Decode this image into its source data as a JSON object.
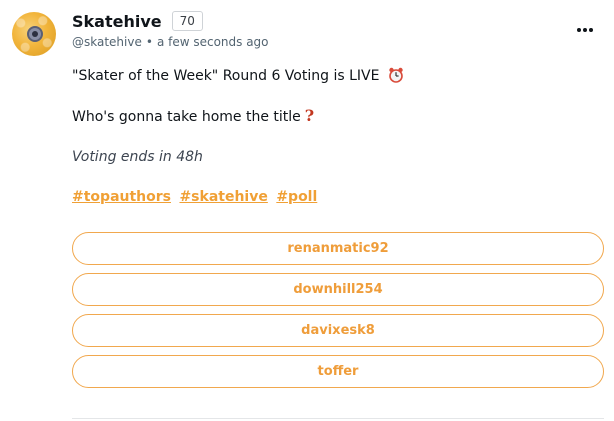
{
  "author": {
    "display_name": "Skatehive",
    "reputation": "70",
    "handle": "@skatehive",
    "separator": "•",
    "timestamp": "a few seconds ago",
    "avatar_icon": "bee-eye-icon"
  },
  "menu": {
    "icon": "more-horizontal-icon"
  },
  "post": {
    "line1": "\"Skater of the Week\" Round 6 Voting is LIVE",
    "line1_icon": "alarm-clock-icon",
    "line2": "Who's gonna take home the title",
    "line2_icon": "?",
    "line3": "Voting ends in 48h",
    "hashtags": [
      "#topauthors",
      "#skatehive",
      "#poll"
    ]
  },
  "poll": {
    "options": [
      "renanmatic92",
      "downhill254",
      "davixesk8",
      "toffer"
    ]
  },
  "colors": {
    "accent": "#f1a84e",
    "accent_text": "#ef9d3a",
    "text": "#0f1419",
    "muted": "#536471"
  }
}
